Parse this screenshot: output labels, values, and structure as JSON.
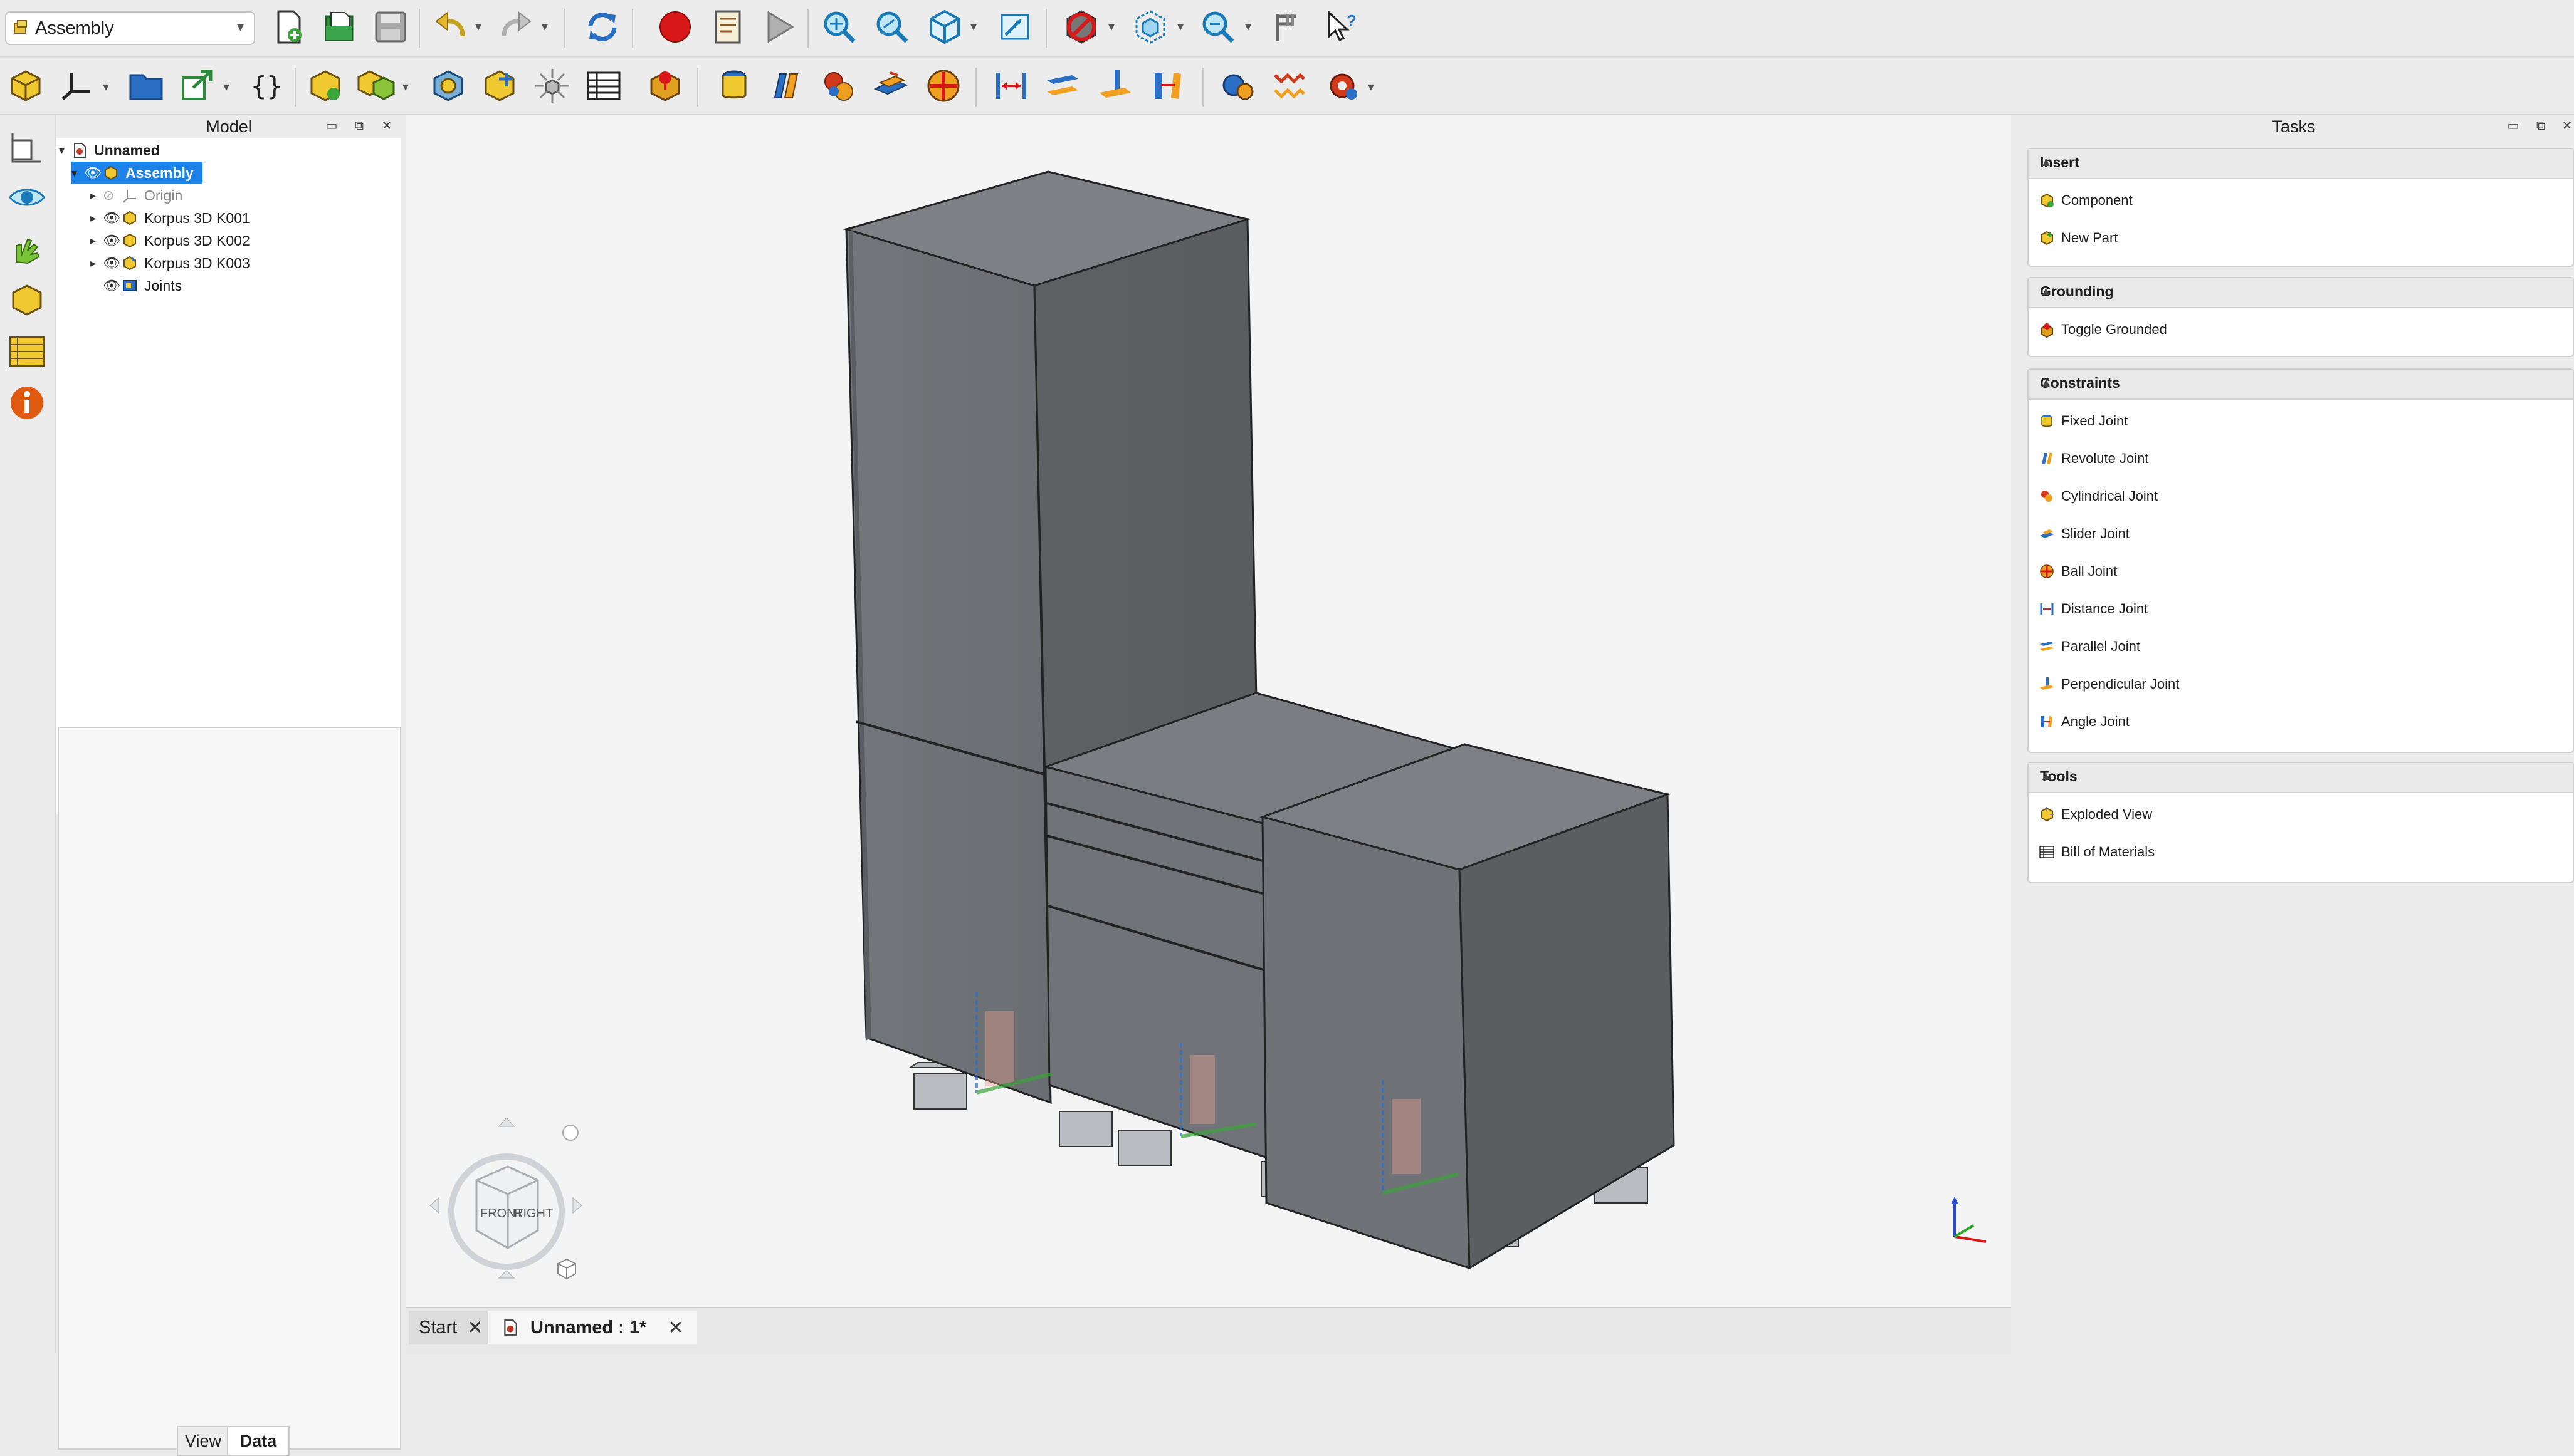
{
  "workbench": {
    "label": "Assembly"
  },
  "model_panel": {
    "title": "Model",
    "tree": [
      {
        "label": "Unnamed",
        "bold": true
      },
      {
        "label": "Assembly",
        "selected": true
      },
      {
        "label": "Origin"
      },
      {
        "label": "Korpus 3D  K001"
      },
      {
        "label": "Korpus 3D  K002"
      },
      {
        "label": "Korpus 3D  K003"
      },
      {
        "label": "Joints"
      }
    ],
    "tabs": [
      "View",
      "Data"
    ],
    "active_tab": "Data"
  },
  "tasks_panel": {
    "title": "Tasks",
    "sections": [
      {
        "title": "Insert",
        "items": [
          "Component",
          "New Part"
        ]
      },
      {
        "title": "Grounding",
        "items": [
          "Toggle Grounded"
        ]
      },
      {
        "title": "Constraints",
        "items": [
          "Fixed Joint",
          "Revolute Joint",
          "Cylindrical Joint",
          "Slider Joint",
          "Ball Joint",
          "Distance Joint",
          "Parallel Joint",
          "Perpendicular Joint",
          "Angle Joint"
        ]
      },
      {
        "title": "Tools",
        "items": [
          "Exploded View",
          "Bill of Materials"
        ]
      }
    ]
  },
  "navcube": {
    "front": "FRONT",
    "right": "RIGHT"
  },
  "doc_tabs": [
    "Start",
    "Unnamed : 1*"
  ],
  "colors": {
    "selection": "#3478f6",
    "background": "#f4f4f4",
    "cabinet": "#6e7175"
  }
}
